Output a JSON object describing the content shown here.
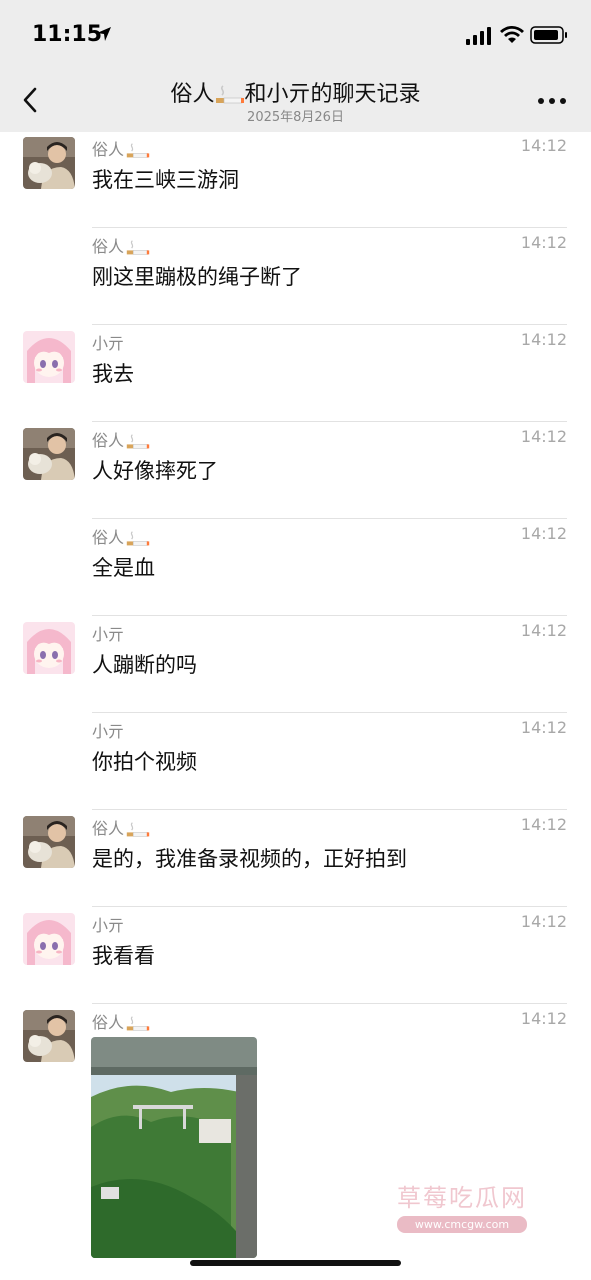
{
  "status_bar": {
    "time": "11:15"
  },
  "header": {
    "title_a": "俗人",
    "title_b": "和小亓的聊天记录",
    "date": "2025年8月26日"
  },
  "messages": [
    {
      "sender": "俗人",
      "avatar": "boy-with-dog",
      "show_avatar": true,
      "time": "14:12",
      "text": "我在三峡三游洞"
    },
    {
      "sender": "俗人",
      "avatar": "boy-with-dog",
      "show_avatar": false,
      "time": "14:12",
      "text": "刚这里蹦极的绳子断了"
    },
    {
      "sender": "小亓",
      "avatar": "anime-girl-pink",
      "show_avatar": true,
      "time": "14:12",
      "text": "我去"
    },
    {
      "sender": "俗人",
      "avatar": "boy-with-dog",
      "show_avatar": true,
      "time": "14:12",
      "text": "人好像摔死了"
    },
    {
      "sender": "俗人",
      "avatar": "boy-with-dog",
      "show_avatar": false,
      "time": "14:12",
      "text": "全是血"
    },
    {
      "sender": "小亓",
      "avatar": "anime-girl-pink",
      "show_avatar": true,
      "time": "14:12",
      "text": "人蹦断的吗"
    },
    {
      "sender": "小亓",
      "avatar": "anime-girl-pink",
      "show_avatar": false,
      "time": "14:12",
      "text": "你拍个视频"
    },
    {
      "sender": "俗人",
      "avatar": "boy-with-dog",
      "show_avatar": true,
      "time": "14:12",
      "text": "是的，我准备录视频的，正好拍到"
    },
    {
      "sender": "小亓",
      "avatar": "anime-girl-pink",
      "show_avatar": true,
      "time": "14:12",
      "text": "我看看"
    },
    {
      "sender": "俗人",
      "avatar": "boy-with-dog",
      "show_avatar": true,
      "time": "14:12",
      "image": "bridge-over-green-valley-photo"
    }
  ],
  "watermark": {
    "text": "草莓吃瓜网",
    "url": "www.cmcgw.com"
  },
  "icons": [
    "location-arrow-icon",
    "signal-icon",
    "wifi-icon",
    "battery-icon",
    "back-chevron-icon",
    "more-icon",
    "cigarette-emoji-icon"
  ]
}
